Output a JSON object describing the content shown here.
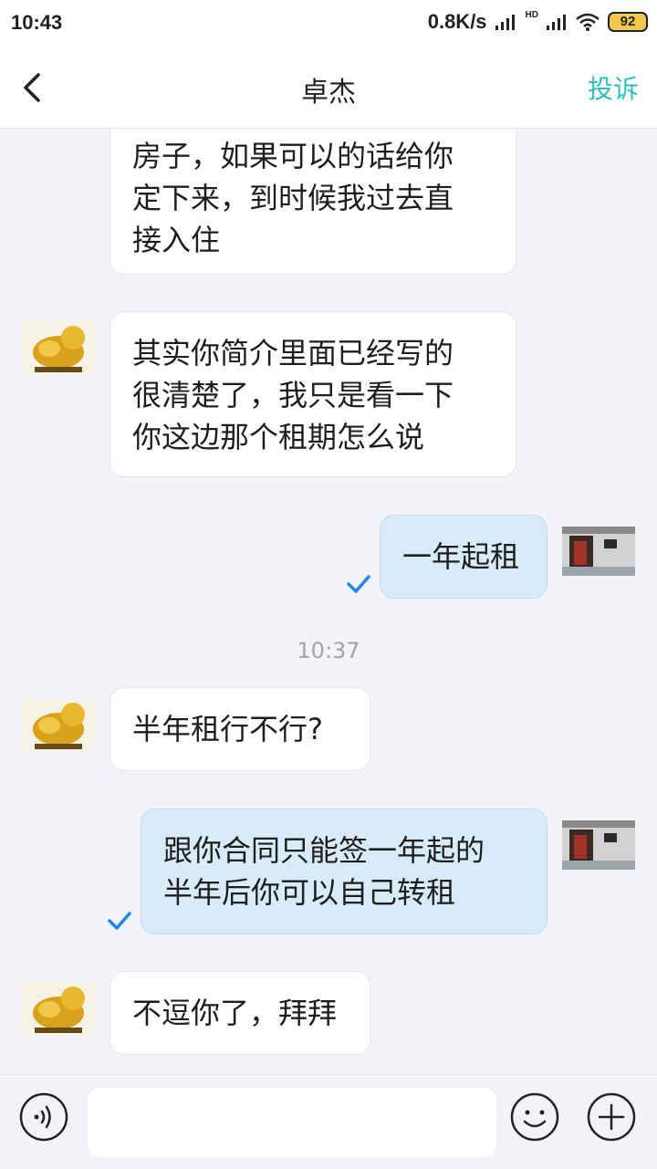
{
  "status_bar": {
    "time": "10:43",
    "network_speed": "0.8K/s",
    "network_type": "HD",
    "battery": "92"
  },
  "header": {
    "title": "卓杰",
    "complain_label": "投诉"
  },
  "messages": [
    {
      "sender": "other",
      "lines": [
        "房子，如果可以的话给你",
        "定下来，到时候我过去直",
        "接入住"
      ]
    },
    {
      "sender": "other",
      "lines": [
        "其实你简介里面已经写的",
        "很清楚了，我只是看一下",
        "你这边那个租期怎么说"
      ]
    },
    {
      "sender": "me",
      "lines": [
        "一年起租"
      ],
      "read": true
    },
    {
      "sender": "other",
      "lines": [
        "半年租行不行?"
      ]
    },
    {
      "sender": "me",
      "lines": [
        "跟你合同只能签一年起的",
        "半年后你可以自己转租"
      ],
      "read": true
    },
    {
      "sender": "other",
      "lines": [
        "不逗你了，拜拜"
      ]
    }
  ],
  "timestamp": "10:37",
  "input": {
    "value": "",
    "placeholder": ""
  },
  "colors": {
    "accent": "#2bbfc0",
    "read_check": "#1e88e5",
    "outgoing_bubble": "#d7ebf9"
  },
  "icons": [
    "back-arrow-icon",
    "voice-icon",
    "emoji-icon",
    "plus-icon",
    "read-check-icon"
  ]
}
